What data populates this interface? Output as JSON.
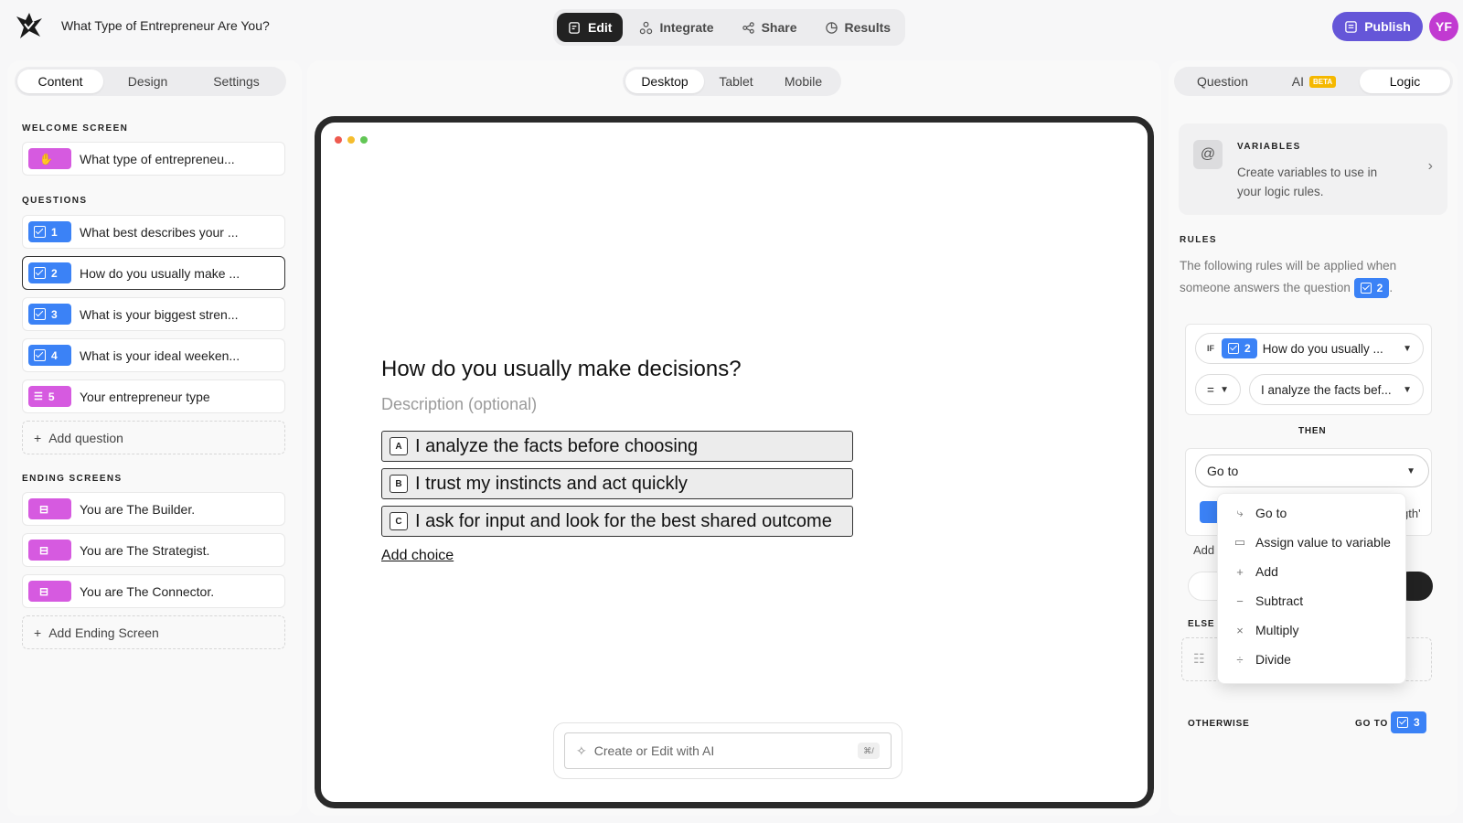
{
  "header": {
    "title": "What Type of Entrepreneur Are You?",
    "tabs": [
      {
        "label": "Edit",
        "icon": "edit-icon"
      },
      {
        "label": "Integrate",
        "icon": "integrate-icon"
      },
      {
        "label": "Share",
        "icon": "share-icon"
      },
      {
        "label": "Results",
        "icon": "results-icon"
      }
    ],
    "publish_label": "Publish",
    "avatar_initials": "YF"
  },
  "left_panel": {
    "tabs": [
      "Content",
      "Design",
      "Settings"
    ],
    "welcome_label": "WELCOME SCREEN",
    "welcome_item": "What type of entrepreneu...",
    "questions_label": "QUESTIONS",
    "questions": [
      {
        "num": "1",
        "text": "What best describes your ...",
        "type": "checkbox"
      },
      {
        "num": "2",
        "text": "How do you usually make ...",
        "type": "checkbox"
      },
      {
        "num": "3",
        "text": "What is your biggest stren...",
        "type": "checkbox"
      },
      {
        "num": "4",
        "text": "What is your ideal weeken...",
        "type": "checkbox"
      },
      {
        "num": "5",
        "text": "Your entrepreneur type",
        "type": "statement"
      }
    ],
    "add_question": "Add question",
    "endings_label": "ENDING SCREENS",
    "endings": [
      "You are The Builder.",
      "You are The Strategist.",
      "You are The Connector."
    ],
    "add_ending": "Add Ending Screen"
  },
  "center": {
    "device_tabs": [
      "Desktop",
      "Tablet",
      "Mobile"
    ],
    "question_title": "How do you usually make decisions?",
    "description_placeholder": "Description (optional)",
    "choices": [
      {
        "key": "A",
        "text": "I analyze the facts before choosing"
      },
      {
        "key": "B",
        "text": "I trust my instincts and act quickly"
      },
      {
        "key": "C",
        "text": "I ask for input and look for the best shared outcome"
      }
    ],
    "add_choice": "Add choice",
    "ai_placeholder": "Create or Edit with AI",
    "ai_shortcut": "⌘/"
  },
  "right_panel": {
    "tabs": [
      "Question",
      "AI",
      "Logic"
    ],
    "ai_badge": "BETA",
    "variables_title": "VARIABLES",
    "variables_desc": "Create variables to use in your logic rules.",
    "rules_label": "RULES",
    "rules_desc": "The following rules will be applied when someone answers the question",
    "rules_question_num": "2",
    "if_label": "IF",
    "if_question_num": "2",
    "if_question": "How do you usually ...",
    "operator": "=",
    "if_value": "I analyze the facts bef...",
    "then_label": "THEN",
    "action": "Go to",
    "bg_fragment_right": "gth'",
    "bg_fragment_add": "Add",
    "dropdown_items": [
      {
        "label": "Go to",
        "icon": "goto-icon"
      },
      {
        "label": "Assign value to variable",
        "icon": "variable-icon"
      },
      {
        "label": "Add",
        "icon": "plus-icon"
      },
      {
        "label": "Subtract",
        "icon": "minus-icon"
      },
      {
        "label": "Multiply",
        "icon": "multiply-icon"
      },
      {
        "label": "Divide",
        "icon": "divide-icon"
      }
    ],
    "else_label": "ELSE",
    "otherwise_label": "OTHERWISE",
    "goto_label": "GO TO",
    "otherwise_num": "3"
  },
  "colors": {
    "publish": "#6556d8",
    "avatar": "#c13ad1",
    "question_badge": "#3b82f6",
    "screen_badge": "#d65ae0",
    "ai_beta": "#f5b800"
  }
}
